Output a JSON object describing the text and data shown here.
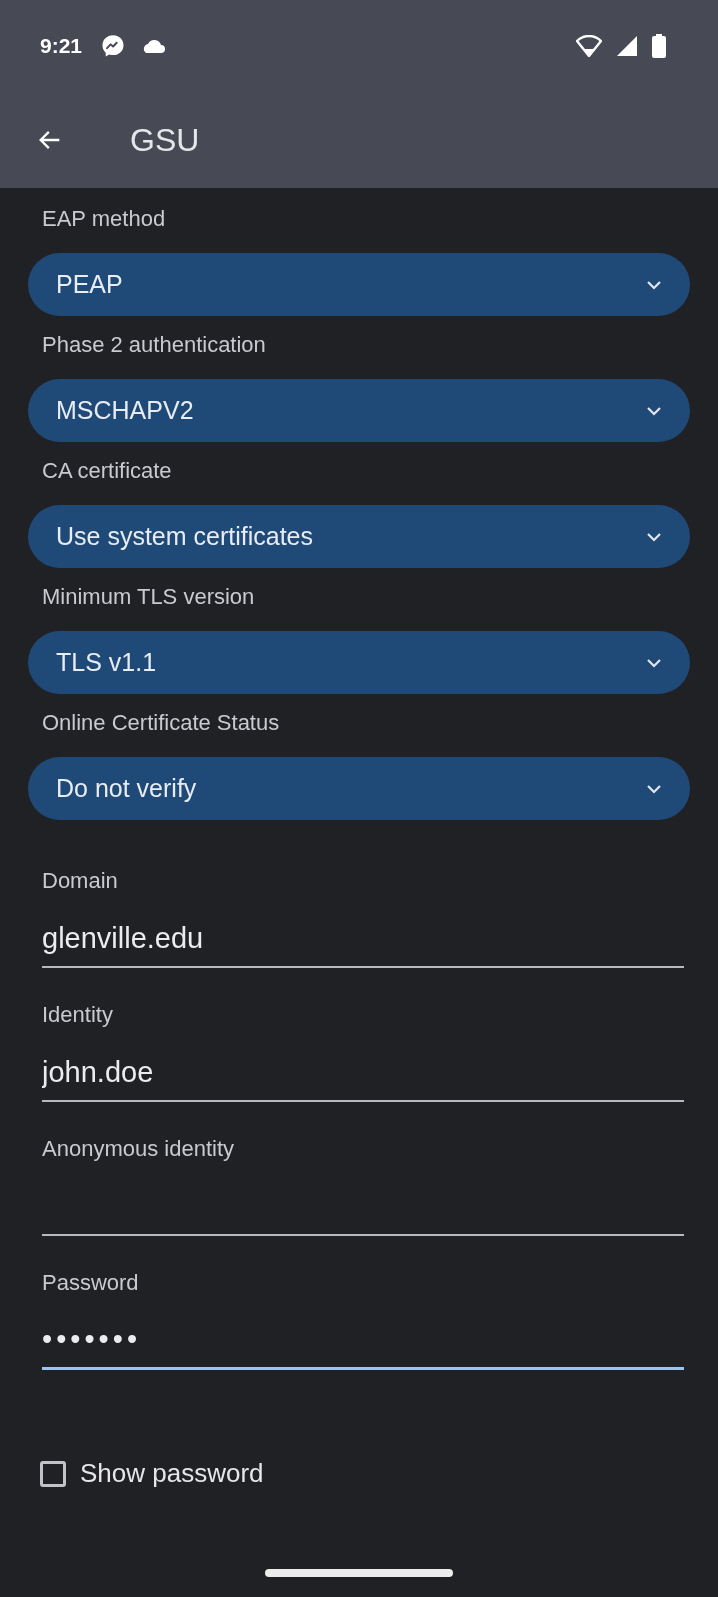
{
  "status_bar": {
    "time": "9:21"
  },
  "app_bar": {
    "title": "GSU"
  },
  "dropdowns": [
    {
      "label": "EAP method",
      "value": "PEAP"
    },
    {
      "label": "Phase 2 authentication",
      "value": "MSCHAPV2"
    },
    {
      "label": "CA certificate",
      "value": "Use system certificates"
    },
    {
      "label": "Minimum TLS version",
      "value": "TLS v1.1"
    },
    {
      "label": "Online Certificate Status",
      "value": "Do not verify"
    }
  ],
  "fields": [
    {
      "label": "Domain",
      "value": "glenville.edu",
      "focused": false
    },
    {
      "label": "Identity",
      "value": "john.doe",
      "focused": false
    },
    {
      "label": "Anonymous identity",
      "focused": false
    },
    {
      "label": "Password",
      "value": "•••••••",
      "focused": true
    }
  ],
  "show_password": {
    "label": "Show password",
    "checked": false
  }
}
